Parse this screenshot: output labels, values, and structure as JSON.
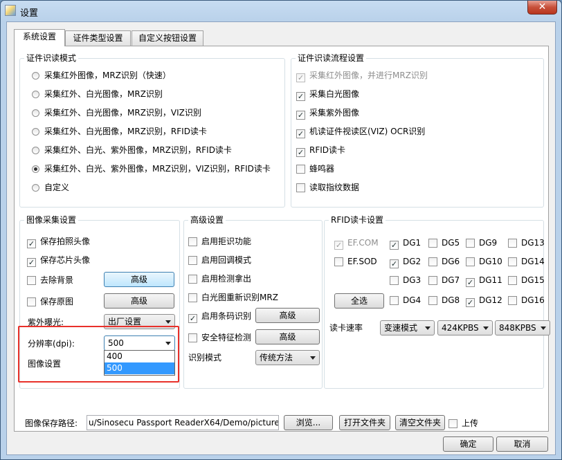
{
  "window": {
    "title": "设置",
    "close_glyph": "✕"
  },
  "tabs": [
    "系统设置",
    "证件类型设置",
    "自定义按钮设置"
  ],
  "read_mode": {
    "title": "证件识读模式",
    "options": [
      "采集红外图像，MRZ识别（快速）",
      "采集红外、白光图像，MRZ识别",
      "采集红外、白光图像，MRZ识别，VIZ识别",
      "采集红外、白光图像，MRZ识别，RFID读卡",
      "采集红外、白光、紫外图像，MRZ识别，RFID读卡",
      "采集红外、白光、紫外图像，MRZ识别，VIZ识别，RFID读卡",
      "自定义"
    ],
    "selected_index": 5
  },
  "flow": {
    "title": "证件识读流程设置",
    "items": [
      {
        "label": "采集红外图像，并进行MRZ识别",
        "checked": true,
        "disabled": true
      },
      {
        "label": "采集白光图像",
        "checked": true,
        "disabled": false
      },
      {
        "label": "采集紫外图像",
        "checked": true,
        "disabled": false
      },
      {
        "label": "机读证件视读区(VIZ) OCR识别",
        "checked": true,
        "disabled": false
      },
      {
        "label": "RFID读卡",
        "checked": true,
        "disabled": false
      },
      {
        "label": "蜂鸣器",
        "checked": false,
        "disabled": false
      },
      {
        "label": "读取指纹数据",
        "checked": false,
        "disabled": false
      }
    ]
  },
  "image": {
    "title": "图像采集设置",
    "save_photo": "保存拍照头像",
    "save_chip": "保存芯片头像",
    "remove_bg": "去除背景",
    "save_original": "保存原图",
    "advanced": "高级",
    "uv_label": "紫外曝光:",
    "uv_value": "出厂设置",
    "dpi_label": "分辨率(dpi):",
    "dpi_value": "500",
    "dpi_options": [
      "400",
      "500"
    ],
    "dpi_selected_index": 1,
    "image_settings": "图像设置"
  },
  "advanced": {
    "title": "高级设置",
    "items": [
      {
        "label": "启用拒识功能",
        "checked": false
      },
      {
        "label": "启用回调模式",
        "checked": false
      },
      {
        "label": "启用检测拿出",
        "checked": false
      },
      {
        "label": "白光图重新识别MRZ",
        "checked": false
      },
      {
        "label": "启用条码识别",
        "checked": true
      },
      {
        "label": "安全特征检测",
        "checked": false
      }
    ],
    "advanced_btn": "高级",
    "recog_label": "识别模式",
    "recog_value": "传统方法"
  },
  "rfid": {
    "title": "RFID读卡设置",
    "ef_com": "EF.COM",
    "ef_sod": "EF.SOD",
    "select_all": "全选",
    "dg": [
      {
        "label": "DG1",
        "checked": true
      },
      {
        "label": "DG2",
        "checked": true
      },
      {
        "label": "DG3",
        "checked": false
      },
      {
        "label": "DG4",
        "checked": false
      },
      {
        "label": "DG5",
        "checked": false
      },
      {
        "label": "DG6",
        "checked": false
      },
      {
        "label": "DG7",
        "checked": false
      },
      {
        "label": "DG8",
        "checked": false
      },
      {
        "label": "DG9",
        "checked": false
      },
      {
        "label": "DG10",
        "checked": false
      },
      {
        "label": "DG11",
        "checked": true
      },
      {
        "label": "DG12",
        "checked": true
      },
      {
        "label": "DG13",
        "checked": false
      },
      {
        "label": "DG14",
        "checked": false
      },
      {
        "label": "DG15",
        "checked": false
      },
      {
        "label": "DG16",
        "checked": false
      }
    ],
    "speed_label": "读卡速率",
    "speed_mode": "变速模式",
    "speed_a": "424KPBS",
    "speed_b": "848KPBS"
  },
  "path": {
    "label": "图像保存路径:",
    "value": "u/Sinosecu Passport ReaderX64/Demo/picture/",
    "browse": "浏览...",
    "open": "打开文件夹",
    "clear": "清空文件夹",
    "upload": "上传"
  },
  "footer": {
    "ok": "确定",
    "cancel": "取消"
  },
  "colors": {
    "highlight": "#e8302a",
    "selection": "#3399ff"
  }
}
